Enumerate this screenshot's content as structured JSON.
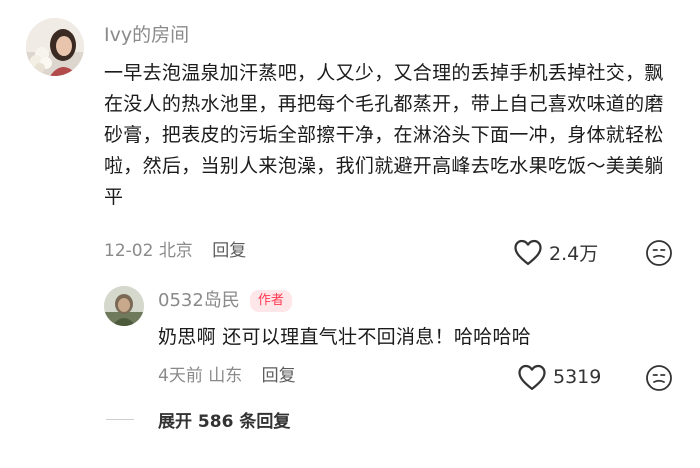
{
  "main_comment": {
    "username": "Ivy的房间",
    "text": "一早去泡温泉加汗蒸吧，人又少，又合理的丢掉手机丢掉社交，飘在没人的热水池里，再把每个毛孔都蒸开，带上自己喜欢味道的磨砂膏，把表皮的污垢全部擦干净，在淋浴头下面一冲，身体就轻松啦，然后，当别人来泡澡，我们就避开高峰去吃水果吃饭～美美躺平",
    "date": "12-02",
    "location": "北京",
    "reply_label": "回复",
    "like_count": "2.4万",
    "like_icon": "heart-outline-icon",
    "dislike_icon": "meh-face-icon"
  },
  "reply_comment": {
    "username": "0532岛民",
    "badge": "作者",
    "text": "奶思啊 还可以理直气壮不回消息！哈哈哈哈",
    "date": "4天前",
    "location": "山东",
    "reply_label": "回复",
    "like_count": "5319"
  },
  "expand": {
    "label": "展开 586 条回复"
  },
  "colors": {
    "badge_bg": "#ffe6e8",
    "badge_text": "#ff3b52",
    "meta_gray": "#8a8a8a"
  }
}
